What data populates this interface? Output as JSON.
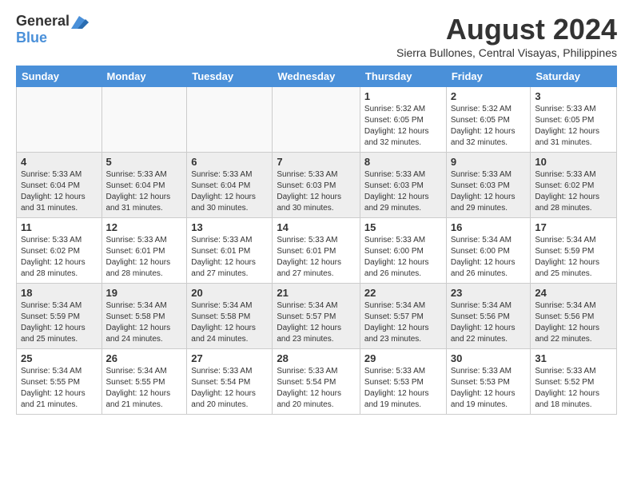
{
  "header": {
    "logo_general": "General",
    "logo_blue": "Blue",
    "title": "August 2024",
    "subtitle": "Sierra Bullones, Central Visayas, Philippines"
  },
  "days_of_week": [
    "Sunday",
    "Monday",
    "Tuesday",
    "Wednesday",
    "Thursday",
    "Friday",
    "Saturday"
  ],
  "weeks": [
    {
      "days": [
        {
          "num": "",
          "info": ""
        },
        {
          "num": "",
          "info": ""
        },
        {
          "num": "",
          "info": ""
        },
        {
          "num": "",
          "info": ""
        },
        {
          "num": "1",
          "info": "Sunrise: 5:32 AM\nSunset: 6:05 PM\nDaylight: 12 hours\nand 32 minutes."
        },
        {
          "num": "2",
          "info": "Sunrise: 5:32 AM\nSunset: 6:05 PM\nDaylight: 12 hours\nand 32 minutes."
        },
        {
          "num": "3",
          "info": "Sunrise: 5:33 AM\nSunset: 6:05 PM\nDaylight: 12 hours\nand 31 minutes."
        }
      ]
    },
    {
      "days": [
        {
          "num": "4",
          "info": "Sunrise: 5:33 AM\nSunset: 6:04 PM\nDaylight: 12 hours\nand 31 minutes."
        },
        {
          "num": "5",
          "info": "Sunrise: 5:33 AM\nSunset: 6:04 PM\nDaylight: 12 hours\nand 31 minutes."
        },
        {
          "num": "6",
          "info": "Sunrise: 5:33 AM\nSunset: 6:04 PM\nDaylight: 12 hours\nand 30 minutes."
        },
        {
          "num": "7",
          "info": "Sunrise: 5:33 AM\nSunset: 6:03 PM\nDaylight: 12 hours\nand 30 minutes."
        },
        {
          "num": "8",
          "info": "Sunrise: 5:33 AM\nSunset: 6:03 PM\nDaylight: 12 hours\nand 29 minutes."
        },
        {
          "num": "9",
          "info": "Sunrise: 5:33 AM\nSunset: 6:03 PM\nDaylight: 12 hours\nand 29 minutes."
        },
        {
          "num": "10",
          "info": "Sunrise: 5:33 AM\nSunset: 6:02 PM\nDaylight: 12 hours\nand 28 minutes."
        }
      ]
    },
    {
      "days": [
        {
          "num": "11",
          "info": "Sunrise: 5:33 AM\nSunset: 6:02 PM\nDaylight: 12 hours\nand 28 minutes."
        },
        {
          "num": "12",
          "info": "Sunrise: 5:33 AM\nSunset: 6:01 PM\nDaylight: 12 hours\nand 28 minutes."
        },
        {
          "num": "13",
          "info": "Sunrise: 5:33 AM\nSunset: 6:01 PM\nDaylight: 12 hours\nand 27 minutes."
        },
        {
          "num": "14",
          "info": "Sunrise: 5:33 AM\nSunset: 6:01 PM\nDaylight: 12 hours\nand 27 minutes."
        },
        {
          "num": "15",
          "info": "Sunrise: 5:33 AM\nSunset: 6:00 PM\nDaylight: 12 hours\nand 26 minutes."
        },
        {
          "num": "16",
          "info": "Sunrise: 5:34 AM\nSunset: 6:00 PM\nDaylight: 12 hours\nand 26 minutes."
        },
        {
          "num": "17",
          "info": "Sunrise: 5:34 AM\nSunset: 5:59 PM\nDaylight: 12 hours\nand 25 minutes."
        }
      ]
    },
    {
      "days": [
        {
          "num": "18",
          "info": "Sunrise: 5:34 AM\nSunset: 5:59 PM\nDaylight: 12 hours\nand 25 minutes."
        },
        {
          "num": "19",
          "info": "Sunrise: 5:34 AM\nSunset: 5:58 PM\nDaylight: 12 hours\nand 24 minutes."
        },
        {
          "num": "20",
          "info": "Sunrise: 5:34 AM\nSunset: 5:58 PM\nDaylight: 12 hours\nand 24 minutes."
        },
        {
          "num": "21",
          "info": "Sunrise: 5:34 AM\nSunset: 5:57 PM\nDaylight: 12 hours\nand 23 minutes."
        },
        {
          "num": "22",
          "info": "Sunrise: 5:34 AM\nSunset: 5:57 PM\nDaylight: 12 hours\nand 23 minutes."
        },
        {
          "num": "23",
          "info": "Sunrise: 5:34 AM\nSunset: 5:56 PM\nDaylight: 12 hours\nand 22 minutes."
        },
        {
          "num": "24",
          "info": "Sunrise: 5:34 AM\nSunset: 5:56 PM\nDaylight: 12 hours\nand 22 minutes."
        }
      ]
    },
    {
      "days": [
        {
          "num": "25",
          "info": "Sunrise: 5:34 AM\nSunset: 5:55 PM\nDaylight: 12 hours\nand 21 minutes."
        },
        {
          "num": "26",
          "info": "Sunrise: 5:34 AM\nSunset: 5:55 PM\nDaylight: 12 hours\nand 21 minutes."
        },
        {
          "num": "27",
          "info": "Sunrise: 5:33 AM\nSunset: 5:54 PM\nDaylight: 12 hours\nand 20 minutes."
        },
        {
          "num": "28",
          "info": "Sunrise: 5:33 AM\nSunset: 5:54 PM\nDaylight: 12 hours\nand 20 minutes."
        },
        {
          "num": "29",
          "info": "Sunrise: 5:33 AM\nSunset: 5:53 PM\nDaylight: 12 hours\nand 19 minutes."
        },
        {
          "num": "30",
          "info": "Sunrise: 5:33 AM\nSunset: 5:53 PM\nDaylight: 12 hours\nand 19 minutes."
        },
        {
          "num": "31",
          "info": "Sunrise: 5:33 AM\nSunset: 5:52 PM\nDaylight: 12 hours\nand 18 minutes."
        }
      ]
    }
  ]
}
